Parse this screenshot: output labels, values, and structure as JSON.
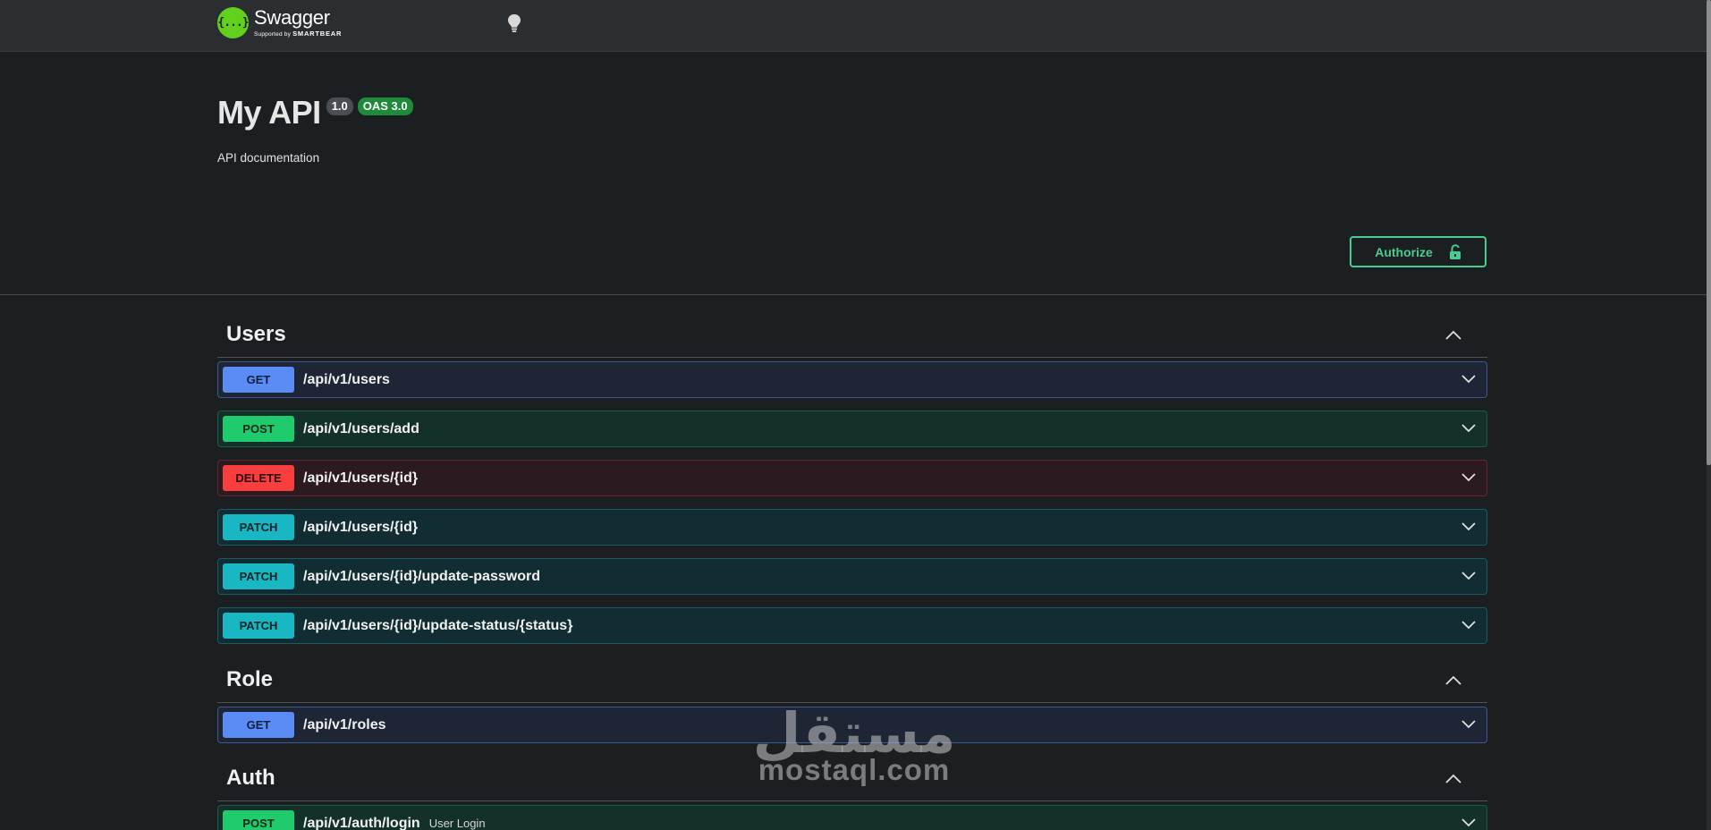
{
  "topbar": {
    "logo_glyph": "{...}",
    "logo_title": "Swagger",
    "logo_supported": "Supported by",
    "logo_brand": "SMARTBEAR",
    "logo_color": "#62d11d",
    "theme_icon": "lightbulb-icon"
  },
  "info": {
    "title": "My API",
    "version": "1.0",
    "oas": "OAS 3.0",
    "description": "API documentation"
  },
  "authorize": {
    "label": "Authorize",
    "icon": "unlocked-padlock-icon",
    "color": "#49cc90"
  },
  "tags": [
    {
      "name": "Users",
      "operations": [
        {
          "method": "GET",
          "path": "/api/v1/users"
        },
        {
          "method": "POST",
          "path": "/api/v1/users/add"
        },
        {
          "method": "DELETE",
          "path": "/api/v1/users/{id}"
        },
        {
          "method": "PATCH",
          "path": "/api/v1/users/{id}"
        },
        {
          "method": "PATCH",
          "path": "/api/v1/users/{id}/update-password"
        },
        {
          "method": "PATCH",
          "path": "/api/v1/users/{id}/update-status/{status}"
        }
      ]
    },
    {
      "name": "Role",
      "operations": [
        {
          "method": "GET",
          "path": "/api/v1/roles"
        }
      ]
    },
    {
      "name": "Auth",
      "operations": [
        {
          "method": "POST",
          "path": "/api/v1/auth/login",
          "summary": "User Login"
        }
      ]
    }
  ],
  "method_colors": {
    "GET": "#5b8cf5",
    "POST": "#1fcb6d",
    "DELETE": "#f93e3e",
    "PATCH": "#19b6c4"
  },
  "watermark": {
    "arabic": "مستقل",
    "latin": "mostaql.com"
  }
}
